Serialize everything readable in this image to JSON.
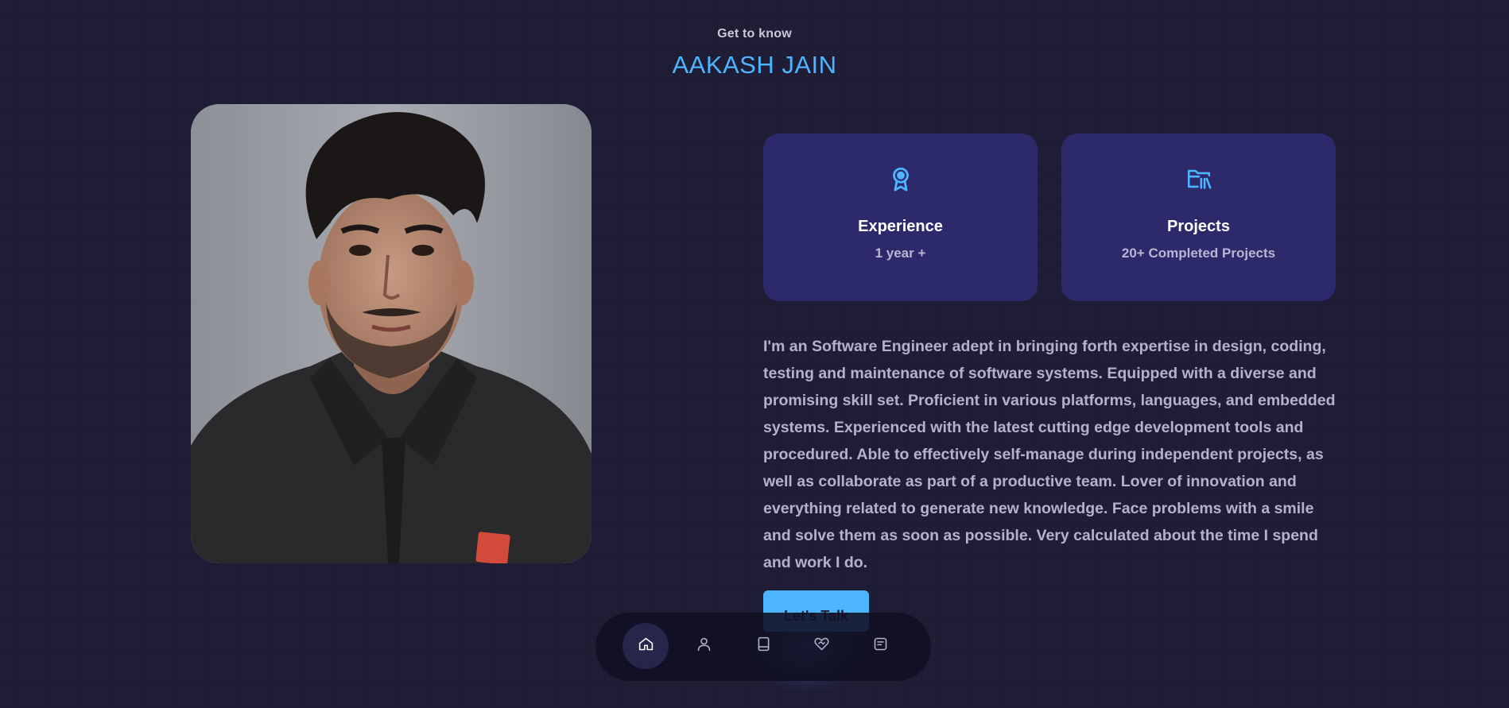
{
  "header": {
    "intro": "Get to know",
    "name": "AAKASH JAIN"
  },
  "profile_photo": {
    "icon": "portrait-photo"
  },
  "cards": [
    {
      "icon": "award-icon",
      "title": "Experience",
      "subtitle": "1 year +"
    },
    {
      "icon": "projects-folder-icon",
      "title": "Projects",
      "subtitle": "20+ Completed Projects"
    }
  ],
  "about": {
    "text": "I'm an Software Engineer adept in bringing forth expertise in design, coding, testing and maintenance of software systems. Equipped with a diverse and promising skill set. Proficient in various platforms, languages, and embedded systems. Experienced with the latest cutting edge development tools and procedured. Able to effectively self-manage during independent projects, as well as collaborate as part of a productive team. Lover of innovation and everything related to generate new knowledge. Face problems with a smile and solve them as soon as possible. Very calculated about the time I spend and work I do."
  },
  "cta": {
    "label": "Let's Talk"
  },
  "nav": {
    "items": [
      {
        "icon": "home-icon",
        "active": true
      },
      {
        "icon": "user-icon",
        "active": false
      },
      {
        "icon": "book-icon",
        "active": false
      },
      {
        "icon": "heart-handshake-icon",
        "active": false
      },
      {
        "icon": "message-icon",
        "active": false
      }
    ]
  },
  "colors": {
    "background": "#1f1d36",
    "accent": "#4db5ff",
    "card": "#2c2a6b",
    "text_muted": "#b4b1cb"
  }
}
